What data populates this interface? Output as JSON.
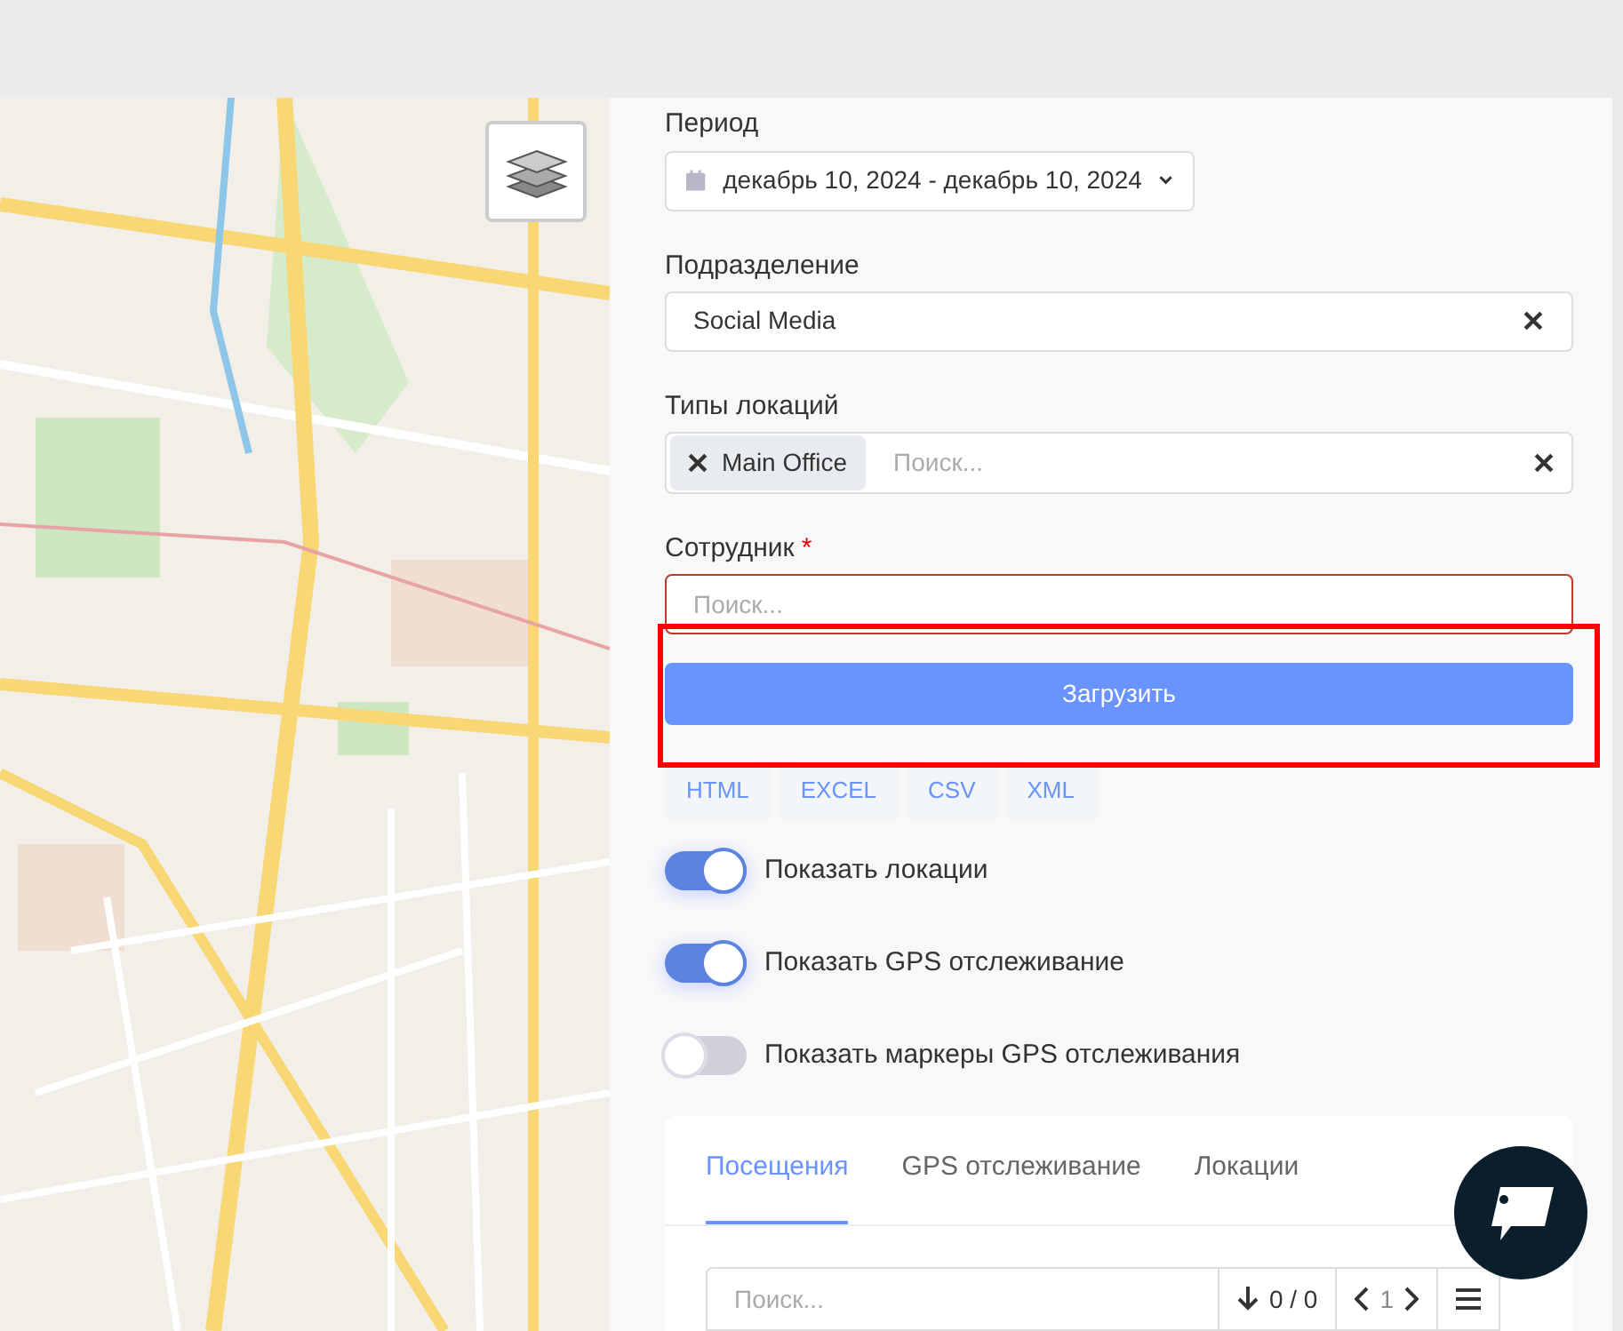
{
  "filters": {
    "period": {
      "label": "Период",
      "value": "декабрь 10, 2024 - декабрь 10, 2024"
    },
    "department": {
      "label": "Подразделение",
      "value": "Social Media"
    },
    "location_types": {
      "label": "Типы локаций",
      "tags": [
        "Main Office"
      ],
      "placeholder": "Поиск..."
    },
    "employee": {
      "label": "Сотрудник",
      "required_mark": "*",
      "placeholder": "Поиск...",
      "invalid": true
    }
  },
  "load_button": "Загрузить",
  "export_buttons": [
    "HTML",
    "EXCEL",
    "CSV",
    "XML"
  ],
  "toggles": [
    {
      "label": "Показать локации",
      "on": true
    },
    {
      "label": "Показать GPS отслеживание",
      "on": true
    },
    {
      "label": "Показать маркеры GPS отслеживания",
      "on": false
    }
  ],
  "tabs": [
    {
      "label": "Посещения",
      "selected": true
    },
    {
      "label": "GPS отслеживание",
      "selected": false
    },
    {
      "label": "Локации",
      "selected": false
    }
  ],
  "table_toolbar": {
    "placeholder": "Поиск...",
    "count": "0 / 0",
    "page": "1"
  }
}
